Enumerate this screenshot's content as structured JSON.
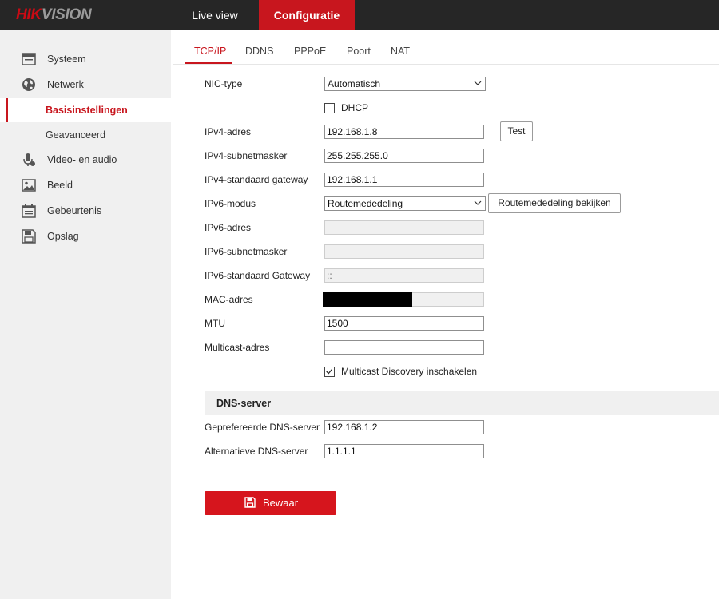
{
  "header": {
    "logo_text": "HIKVISION",
    "nav": {
      "live_view": "Live view",
      "configuratie": "Configuratie"
    }
  },
  "sidebar": {
    "items": [
      {
        "label": "Systeem",
        "icon": "system-icon"
      },
      {
        "label": "Netwerk",
        "icon": "globe-icon"
      },
      {
        "label": "Basisinstellingen",
        "active": true
      },
      {
        "label": "Geavanceerd"
      },
      {
        "label": "Video- en audio",
        "icon": "microphone-icon"
      },
      {
        "label": "Beeld",
        "icon": "image-icon"
      },
      {
        "label": "Gebeurtenis",
        "icon": "calendar-icon"
      },
      {
        "label": "Opslag",
        "icon": "storage-icon"
      }
    ]
  },
  "tabs": [
    "TCP/IP",
    "DDNS",
    "PPPoE",
    "Poort",
    "NAT"
  ],
  "active_tab": "TCP/IP",
  "form": {
    "nic_type": {
      "label": "NIC-type",
      "value": "Automatisch"
    },
    "dhcp": {
      "label": "DHCP",
      "checked": false
    },
    "ipv4_address": {
      "label": "IPv4-adres",
      "value": "192.168.1.8"
    },
    "test_button": "Test",
    "ipv4_subnet": {
      "label": "IPv4-subnetmasker",
      "value": "255.255.255.0"
    },
    "ipv4_gateway": {
      "label": "IPv4-standaard gateway",
      "value": "192.168.1.1"
    },
    "ipv6_mode": {
      "label": "IPv6-modus",
      "value": "Routemededeling"
    },
    "route_button": "Routemededeling bekijken",
    "ipv6_address": {
      "label": "IPv6-adres",
      "value": ""
    },
    "ipv6_subnet": {
      "label": "IPv6-subnetmasker",
      "value": ""
    },
    "ipv6_gateway": {
      "label": "IPv6-standaard Gateway",
      "value": "::"
    },
    "mac": {
      "label": "MAC-adres"
    },
    "mtu": {
      "label": "MTU",
      "value": "1500"
    },
    "multicast": {
      "label": "Multicast-adres",
      "value": ""
    },
    "multicast_discovery": {
      "label": "Multicast Discovery inschakelen",
      "checked": true
    }
  },
  "dns": {
    "header": "DNS-server",
    "preferred": {
      "label": "Geprefereerde DNS-server",
      "value": "192.168.1.2"
    },
    "alternate": {
      "label": "Alternatieve DNS-server",
      "value": "1.1.1.1"
    }
  },
  "save_button": "Bewaar",
  "colors": {
    "accent": "#c8161e",
    "topbar": "#262626",
    "sidebar": "#f0f0f0"
  }
}
